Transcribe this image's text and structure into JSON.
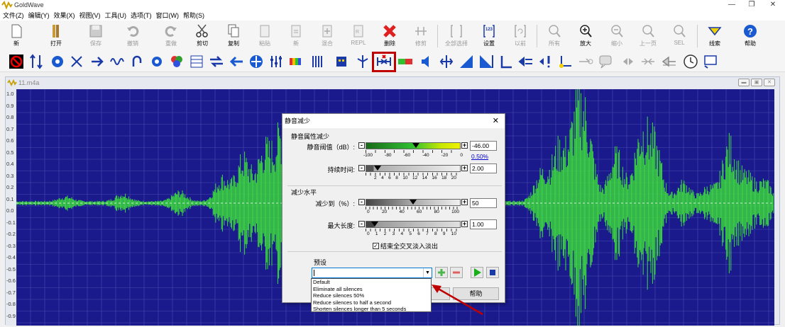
{
  "app": {
    "title": "GoldWave"
  },
  "window_controls": {
    "minimize": "—",
    "maximize": "❐",
    "close": "✕"
  },
  "menu": [
    "文件(Z)",
    "编辑(Y)",
    "效果(X)",
    "视图(V)",
    "工具(U)",
    "选项(T)",
    "窗口(W)",
    "帮助(S)"
  ],
  "toolbar": [
    {
      "label": "新",
      "icon": "new-file-icon",
      "enabled": true
    },
    {
      "label": "打开",
      "icon": "open-folder-icon",
      "enabled": true
    },
    {
      "label": "保存",
      "icon": "save-icon",
      "enabled": false
    },
    {
      "label": "撤销",
      "icon": "undo-icon",
      "enabled": false
    },
    {
      "label": "重做",
      "icon": "redo-icon",
      "enabled": false
    },
    {
      "label": "剪切",
      "icon": "cut-icon",
      "enabled": true
    },
    {
      "label": "复制",
      "icon": "copy-icon",
      "enabled": true
    },
    {
      "label": "粘贴",
      "icon": "paste-icon",
      "enabled": false
    },
    {
      "label": "新",
      "icon": "paste-new-icon",
      "enabled": false
    },
    {
      "label": "混合",
      "icon": "mix-icon",
      "enabled": false
    },
    {
      "label": "REPL",
      "icon": "replace-icon",
      "enabled": false
    },
    {
      "label": "删除",
      "icon": "delete-icon",
      "enabled": true
    },
    {
      "label": "修剪",
      "icon": "trim-icon",
      "enabled": false
    },
    {
      "label": "全部选择",
      "icon": "select-all-icon",
      "enabled": false
    },
    {
      "label": "设置",
      "icon": "set-icon",
      "enabled": true
    },
    {
      "label": "以前",
      "icon": "previous-icon",
      "enabled": false
    },
    {
      "label": "所有",
      "icon": "zoom-all-icon",
      "enabled": false
    },
    {
      "label": "放大",
      "icon": "zoom-in-icon",
      "enabled": true
    },
    {
      "label": "缩小",
      "icon": "zoom-out-icon",
      "enabled": false
    },
    {
      "label": "上一页",
      "icon": "prev-page-icon",
      "enabled": false
    },
    {
      "label": "SEL",
      "icon": "zoom-selection-icon",
      "enabled": false
    },
    {
      "label": "线索",
      "icon": "cue-icon",
      "enabled": true
    },
    {
      "label": "帮助",
      "icon": "help-icon",
      "enabled": true
    }
  ],
  "document": {
    "title": "11.m4a"
  },
  "waveform": {
    "y_ticks": [
      "1.0",
      "0.9",
      "0.8",
      "0.7",
      "0.6",
      "0.5",
      "0.4",
      "0.3",
      "0.2",
      "0.1",
      "0.0",
      "-0.1",
      "-0.2",
      "-0.3",
      "-0.4",
      "-0.5",
      "-0.6",
      "-0.7",
      "-0.8",
      "-0.9"
    ],
    "bg_color": "#1a1a8c",
    "wave_color": "#3cdc3c"
  },
  "dialog": {
    "title": "静音减少",
    "close": "✕",
    "group1": "静音属性减少",
    "threshold": {
      "label": "静音阀值（dB）:",
      "value": "-46.00",
      "percent": "0.50%",
      "ticks": [
        "-100",
        "-80",
        "-60",
        "-40",
        "-20",
        "0"
      ]
    },
    "duration": {
      "label": "持续时间:",
      "value": "2.00",
      "ticks": [
        "2",
        "4",
        "6",
        "8",
        "10",
        "12",
        "14",
        "16",
        "18",
        "20"
      ]
    },
    "group2": "减少水平",
    "reduce_to": {
      "label": "减少到（%）:",
      "value": "50",
      "ticks": [
        "0",
        "20",
        "40",
        "60",
        "80",
        "100"
      ]
    },
    "max_length": {
      "label": "最大长度:",
      "value": "1.00",
      "ticks": [
        "0",
        "1",
        "2",
        "3",
        "4",
        "5",
        "6",
        "7",
        "8",
        "9",
        "10"
      ]
    },
    "crossfade": {
      "label": "结束全交叉淡入淡出",
      "checked": true
    },
    "preset": {
      "label": "预设",
      "value": ""
    },
    "help_button": "帮助"
  },
  "preset_options": [
    "Default",
    "Eliminate all silences",
    "Reduce silences 50%",
    "Reduce silences to half a second",
    "Shorten silences longer than 5 seconds"
  ]
}
